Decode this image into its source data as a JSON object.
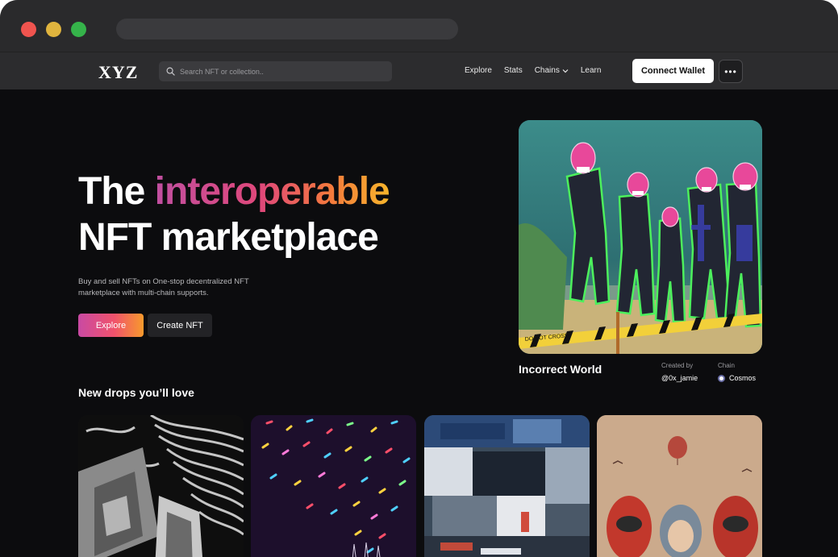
{
  "nav": {
    "logo": "XYZ",
    "search_placeholder": "Search NFT or collection..",
    "links": [
      "Explore",
      "Stats",
      "Chains",
      "Learn"
    ],
    "connect_label": "Connect Wallet",
    "more_label": "•••"
  },
  "hero": {
    "title_line1_plain": "The ",
    "title_line1_gradient": "interoperable",
    "title_line2": "NFT marketplace",
    "subtitle": "Buy and sell NFTs on One-stop decentralized NFT marketplace with multi-chain supports.",
    "explore_label": "Explore",
    "create_label": "Create NFT"
  },
  "featured": {
    "title": "Incorrect World",
    "created_by_label": "Created by",
    "creator": "@0x_jamie",
    "chain_label": "Chain",
    "chain": "Cosmos",
    "tape_text": "DO NOT CROSS"
  },
  "drops": {
    "title": "New drops you’ll love"
  },
  "colors": {
    "accent_gradient_start": "#c94aa3",
    "accent_gradient_end": "#f79a2c",
    "background": "#0c0c0e",
    "navbar": "#2c2c2e"
  }
}
